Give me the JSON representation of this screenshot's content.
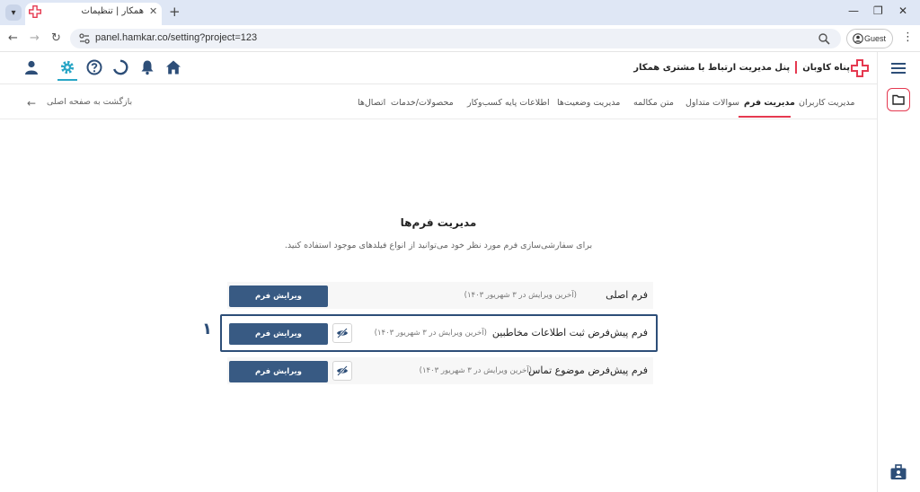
{
  "browser": {
    "tab_title": "همکار | تنظیمات",
    "url": "panel.hamkar.co/setting?project=123",
    "profile_label": "Guest"
  },
  "header": {
    "brand_name": "پناه کاوبان",
    "brand_subtitle": "پنل مدیریت ارتباط با مشتری همکار",
    "icons": [
      "home-icon",
      "bell-icon",
      "loading-icon",
      "help-icon",
      "gear-icon",
      "user-icon"
    ],
    "accent_color": "#e53950",
    "active_icon_color": "#2aa6c6"
  },
  "nav": {
    "tabs": [
      {
        "label": "مدیریت کاربران",
        "active": false
      },
      {
        "label": "مدیریت فرم",
        "active": true
      },
      {
        "label": "سوالات متداول",
        "active": false
      },
      {
        "label": "متن مکالمه",
        "active": false
      },
      {
        "label": "مدیریت وضعیت‌ها",
        "active": false
      },
      {
        "label": "اطلاعات پایه کسب‌وکار",
        "active": false
      },
      {
        "label": "محصولات/خدمات",
        "active": false
      },
      {
        "label": "اتصال‌ها",
        "active": false
      }
    ],
    "back_label": "بازگشت به صفحه اصلی"
  },
  "main": {
    "title": "مدیریت فرم‌ها",
    "subtitle": "برای سفارشی‌سازی فرم مورد نظر خود می‌توانید از انواع فیلدهای موجود استفاده کنید.",
    "forms": [
      {
        "name": "فرم اصلی",
        "meta": "(آخرین ویرایش در ۳ شهریور ۱۴۰۳)",
        "edit_label": "ویرایش فرم",
        "has_hide": false
      },
      {
        "name": "فرم پیش‌فرض ثبت اطلاعات مخاطبین",
        "meta": "(آخرین ویرایش در ۳ شهریور ۱۴۰۳)",
        "edit_label": "ویرایش فرم",
        "has_hide": true
      },
      {
        "name": "فرم پیش‌فرض موضوع تماس",
        "meta": "(آخرین ویرایش در ۳ شهریور ۱۴۰۳)",
        "edit_label": "ویرایش فرم",
        "has_hide": true
      }
    ],
    "step_marker": "۱",
    "button_color": "#385a83"
  }
}
